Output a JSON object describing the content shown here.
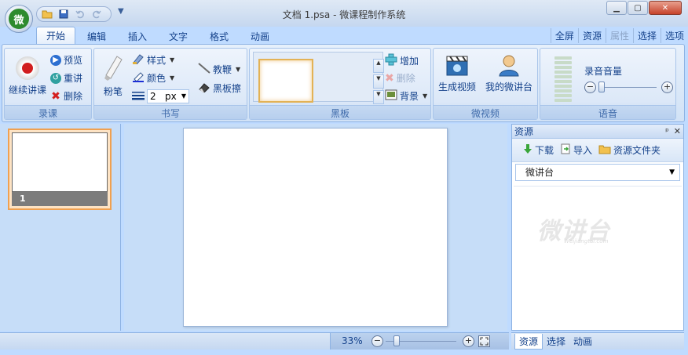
{
  "window": {
    "title": "文档 1.psa - 微课程制作系统",
    "logo_text": "微"
  },
  "tabs": [
    {
      "label": "开始",
      "active": true
    },
    {
      "label": "编辑"
    },
    {
      "label": "插入"
    },
    {
      "label": "文字"
    },
    {
      "label": "格式"
    },
    {
      "label": "动画"
    }
  ],
  "right_menu": [
    {
      "label": "全屏"
    },
    {
      "label": "资源"
    },
    {
      "label": "属性",
      "disabled": true
    },
    {
      "label": "选择"
    },
    {
      "label": "选项"
    }
  ],
  "ribbon": {
    "record": {
      "label": "录课",
      "continue": "继续讲课",
      "preview": "预览",
      "retell": "重讲",
      "delete": "删除"
    },
    "write": {
      "label": "书写",
      "chalk": "粉笔",
      "style": "样式",
      "color": "颜色",
      "size_value": "2",
      "size_unit": "px",
      "pointer": "教鞭",
      "eraser": "黑板擦"
    },
    "board": {
      "label": "黑板",
      "add": "增加",
      "delete": "删除",
      "background": "背景"
    },
    "video": {
      "label": "微视频",
      "generate": "生成视频",
      "my_stage": "我的微讲台"
    },
    "audio": {
      "label": "语音",
      "volume": "录音音量",
      "minus": "−",
      "plus": "+"
    }
  },
  "slides": [
    {
      "number": "1"
    }
  ],
  "resource_panel": {
    "title": "资源",
    "download": "下载",
    "import": "导入",
    "folder": "资源文件夹",
    "selected": "微讲台",
    "watermark": "微讲台",
    "watermark_sub": "Weijiangtai.com"
  },
  "status": {
    "zoom": "33%",
    "minus": "−",
    "plus": "+"
  },
  "bottom_tabs": [
    {
      "label": "资源",
      "active": true
    },
    {
      "label": "选择"
    },
    {
      "label": "动画"
    }
  ]
}
